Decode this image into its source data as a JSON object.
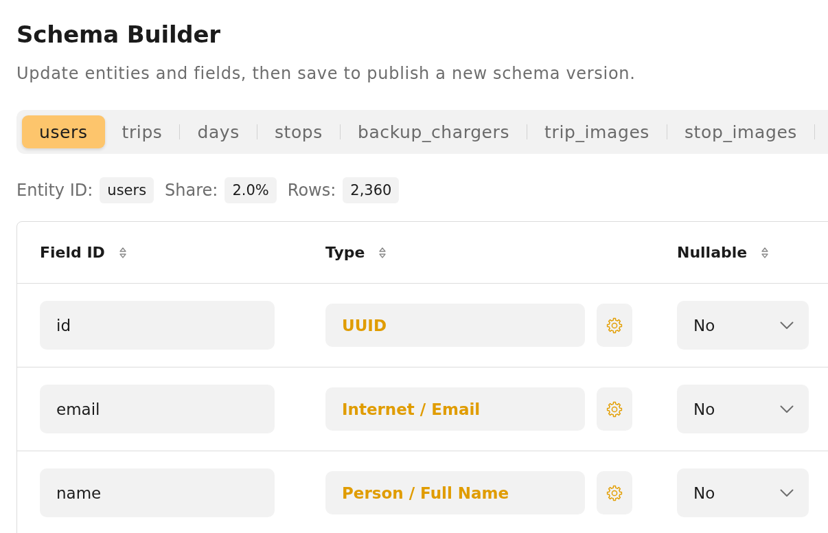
{
  "header": {
    "title": "Schema Builder",
    "subtitle": "Update entities and fields, then save to publish a new schema version."
  },
  "entity_tabs": [
    {
      "label": "users",
      "selected": true
    },
    {
      "label": "trips",
      "selected": false
    },
    {
      "label": "days",
      "selected": false
    },
    {
      "label": "stops",
      "selected": false
    },
    {
      "label": "backup_chargers",
      "selected": false
    },
    {
      "label": "trip_images",
      "selected": false
    },
    {
      "label": "stop_images",
      "selected": false
    }
  ],
  "entity_info": [
    {
      "label": "Entity ID:",
      "value": "users"
    },
    {
      "label": "Share:",
      "value": "2.0%"
    },
    {
      "label": "Rows:",
      "value": "2,360"
    }
  ],
  "table": {
    "columns": [
      "Field ID",
      "Type",
      "Nullable"
    ],
    "rows": [
      {
        "field_id": "id",
        "type": "UUID",
        "nullable": "No"
      },
      {
        "field_id": "email",
        "type": "Internet / Email",
        "nullable": "No"
      },
      {
        "field_id": "name",
        "type": "Person / Full Name",
        "nullable": "No"
      }
    ]
  }
}
